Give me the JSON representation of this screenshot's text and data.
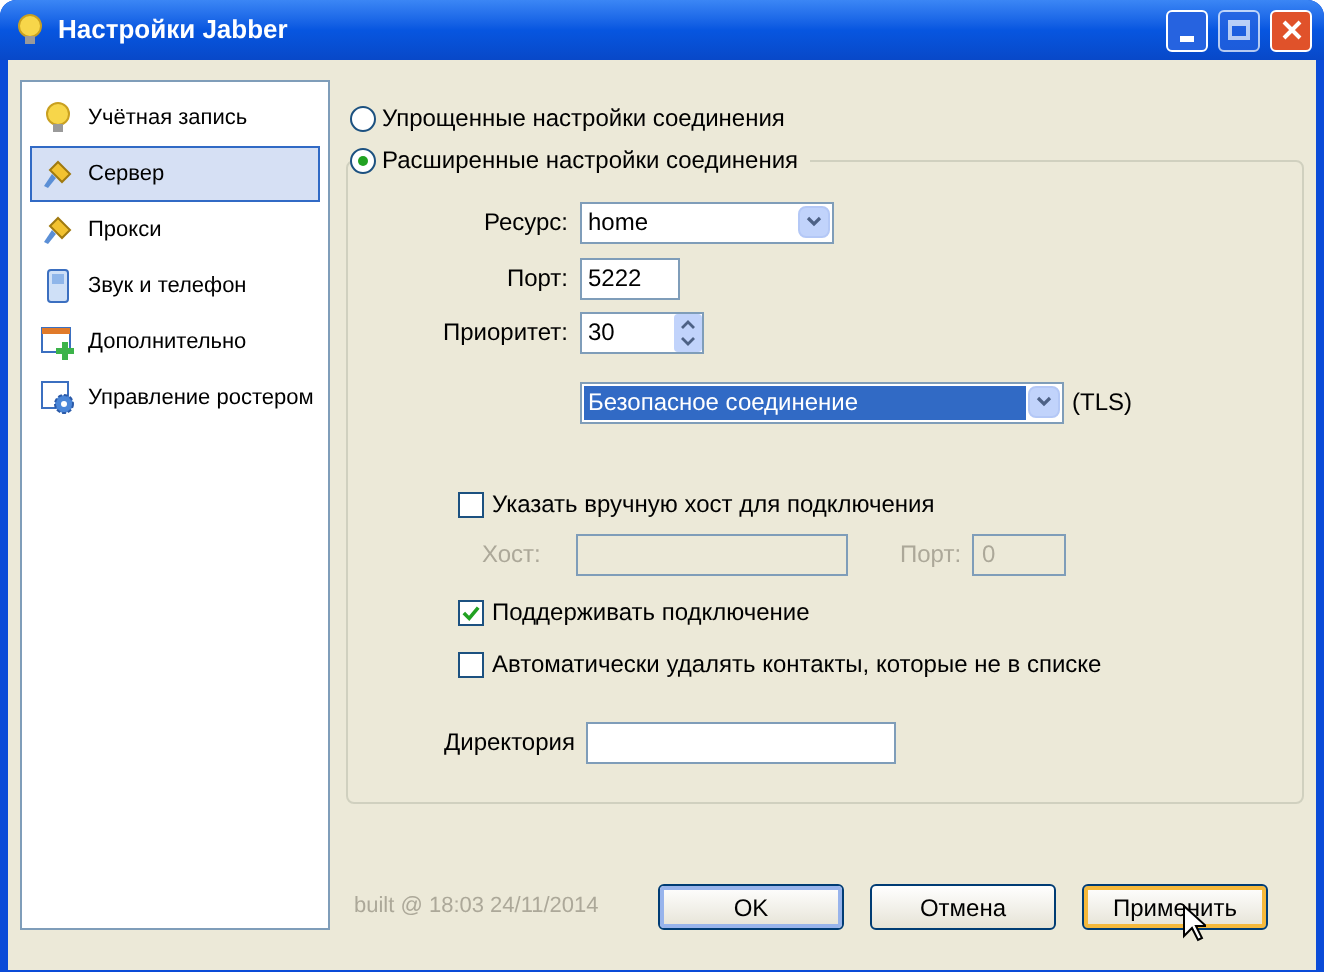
{
  "window": {
    "title": "Настройки Jabber"
  },
  "sidebar": {
    "items": [
      {
        "label": "Учётная запись",
        "selected": false,
        "kind": "bulb"
      },
      {
        "label": "Сервер",
        "selected": true,
        "kind": "brush"
      },
      {
        "label": "Прокси",
        "selected": false,
        "kind": "brush"
      },
      {
        "label": "Звук и телефон",
        "selected": false,
        "kind": "phone"
      },
      {
        "label": "Дополнительно",
        "selected": false,
        "kind": "window"
      },
      {
        "label": "Управление ростером",
        "selected": false,
        "kind": "gear"
      }
    ]
  },
  "connection_modes": [
    {
      "label": "Упрощенные настройки соединения",
      "selected": false
    },
    {
      "label": "Расширенные настройки соединения",
      "selected": true
    }
  ],
  "resource": {
    "label": "Ресурс:",
    "value": "home"
  },
  "port": {
    "label": "Порт:",
    "value": "5222"
  },
  "priority": {
    "label": "Приоритет:",
    "value": "30"
  },
  "security": {
    "value": "Безопасное соединение",
    "suffix": "(TLS)"
  },
  "manual_host": {
    "label": "Указать вручную хост для подключения",
    "checked": false
  },
  "host": {
    "label": "Хост:",
    "disabled": true
  },
  "host_port": {
    "label": "Порт:",
    "value": "0",
    "disabled": true
  },
  "options": [
    {
      "label": "Поддерживать подключение",
      "checked": true
    },
    {
      "label": "Автоматически удалять контакты, которые не в списке",
      "checked": false
    }
  ],
  "directory": {
    "label": "Директория"
  },
  "build_info": "built @ 18:03 24/11/2014",
  "buttons": [
    {
      "label": "OK",
      "default": true,
      "hovered": false
    },
    {
      "label": "Отмена",
      "default": false,
      "hovered": false
    },
    {
      "label": "Применить",
      "default": false,
      "hovered": true
    }
  ]
}
